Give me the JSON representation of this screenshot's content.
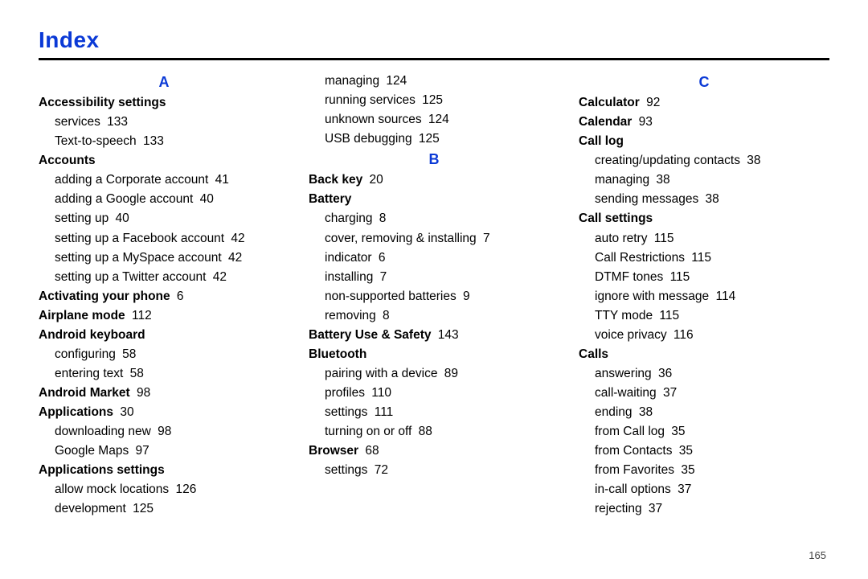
{
  "page_title": "Index",
  "page_number": "165",
  "columns": [
    [
      {
        "kind": "letter",
        "text": "A"
      },
      {
        "kind": "head",
        "text": "Accessibility settings"
      },
      {
        "kind": "sub",
        "text": "services",
        "page": "133"
      },
      {
        "kind": "sub",
        "text": "Text-to-speech",
        "page": "133"
      },
      {
        "kind": "head",
        "text": "Accounts"
      },
      {
        "kind": "sub",
        "text": "adding a Corporate account",
        "page": "41"
      },
      {
        "kind": "sub",
        "text": "adding a Google account",
        "page": "40"
      },
      {
        "kind": "sub",
        "text": "setting up",
        "page": "40"
      },
      {
        "kind": "sub",
        "text": "setting up a Facebook account",
        "page": "42"
      },
      {
        "kind": "sub",
        "text": "setting up a MySpace account",
        "page": "42"
      },
      {
        "kind": "sub",
        "text": "setting up a Twitter account",
        "page": "42"
      },
      {
        "kind": "head",
        "text": "Activating your phone",
        "page": "6"
      },
      {
        "kind": "head",
        "text": "Airplane mode",
        "page": "112"
      },
      {
        "kind": "head",
        "text": "Android keyboard"
      },
      {
        "kind": "sub",
        "text": "configuring",
        "page": "58"
      },
      {
        "kind": "sub",
        "text": "entering text",
        "page": "58"
      },
      {
        "kind": "head",
        "text": "Android Market",
        "page": "98"
      },
      {
        "kind": "head",
        "text": "Applications",
        "page": "30"
      },
      {
        "kind": "sub",
        "text": "downloading new",
        "page": "98"
      },
      {
        "kind": "sub",
        "text": "Google Maps",
        "page": "97"
      },
      {
        "kind": "head",
        "text": "Applications settings"
      },
      {
        "kind": "sub",
        "text": "allow mock locations",
        "page": "126"
      },
      {
        "kind": "sub",
        "text": "development",
        "page": "125"
      }
    ],
    [
      {
        "kind": "sub",
        "text": "managing",
        "page": "124"
      },
      {
        "kind": "sub",
        "text": "running services",
        "page": "125"
      },
      {
        "kind": "sub",
        "text": "unknown sources",
        "page": "124"
      },
      {
        "kind": "sub",
        "text": "USB debugging",
        "page": "125"
      },
      {
        "kind": "letter",
        "text": "B"
      },
      {
        "kind": "head",
        "text": "Back key",
        "page": "20"
      },
      {
        "kind": "head",
        "text": "Battery"
      },
      {
        "kind": "sub",
        "text": "charging",
        "page": "8"
      },
      {
        "kind": "sub",
        "text": "cover, removing & installing",
        "page": "7"
      },
      {
        "kind": "sub",
        "text": "indicator",
        "page": "6"
      },
      {
        "kind": "sub",
        "text": "installing",
        "page": "7"
      },
      {
        "kind": "sub",
        "text": "non-supported batteries",
        "page": "9"
      },
      {
        "kind": "sub",
        "text": "removing",
        "page": "8"
      },
      {
        "kind": "head",
        "text": "Battery Use & Safety",
        "page": "143"
      },
      {
        "kind": "head",
        "text": "Bluetooth"
      },
      {
        "kind": "sub",
        "text": "pairing with a device",
        "page": "89"
      },
      {
        "kind": "sub",
        "text": "profiles",
        "page": "110"
      },
      {
        "kind": "sub",
        "text": "settings",
        "page": "111"
      },
      {
        "kind": "sub",
        "text": "turning on or off",
        "page": "88"
      },
      {
        "kind": "head",
        "text": "Browser",
        "page": "68"
      },
      {
        "kind": "sub",
        "text": "settings",
        "page": "72"
      }
    ],
    [
      {
        "kind": "letter",
        "text": "C"
      },
      {
        "kind": "head",
        "text": "Calculator",
        "page": "92"
      },
      {
        "kind": "head",
        "text": "Calendar",
        "page": "93"
      },
      {
        "kind": "head",
        "text": "Call log"
      },
      {
        "kind": "sub",
        "text": "creating/updating contacts",
        "page": "38"
      },
      {
        "kind": "sub",
        "text": "managing",
        "page": "38"
      },
      {
        "kind": "sub",
        "text": "sending messages",
        "page": "38"
      },
      {
        "kind": "head",
        "text": "Call settings"
      },
      {
        "kind": "sub",
        "text": "auto retry",
        "page": "115"
      },
      {
        "kind": "sub",
        "text": "Call Restrictions",
        "page": "115"
      },
      {
        "kind": "sub",
        "text": "DTMF tones",
        "page": "115"
      },
      {
        "kind": "sub",
        "text": "ignore with message",
        "page": "114"
      },
      {
        "kind": "sub",
        "text": "TTY mode",
        "page": "115"
      },
      {
        "kind": "sub",
        "text": "voice privacy",
        "page": "116"
      },
      {
        "kind": "head",
        "text": "Calls"
      },
      {
        "kind": "sub",
        "text": "answering",
        "page": "36"
      },
      {
        "kind": "sub",
        "text": "call-waiting",
        "page": "37"
      },
      {
        "kind": "sub",
        "text": "ending",
        "page": "38"
      },
      {
        "kind": "sub",
        "text": "from Call log",
        "page": "35"
      },
      {
        "kind": "sub",
        "text": "from Contacts",
        "page": "35"
      },
      {
        "kind": "sub",
        "text": "from Favorites",
        "page": "35"
      },
      {
        "kind": "sub",
        "text": "in-call options",
        "page": "37"
      },
      {
        "kind": "sub",
        "text": "rejecting",
        "page": "37"
      }
    ]
  ]
}
